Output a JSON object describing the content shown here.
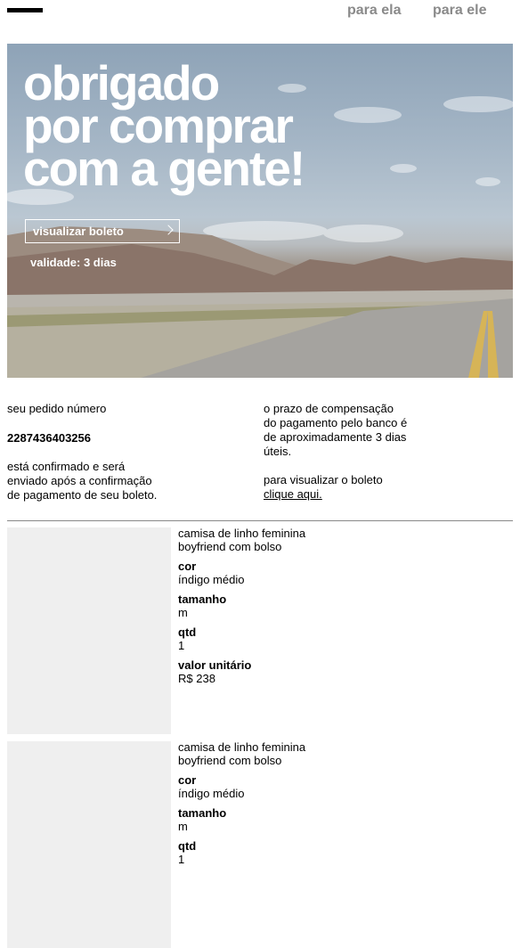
{
  "nav": {
    "link_ela": "para ela",
    "link_ele": "para ele"
  },
  "hero": {
    "title": "obrigado\npor comprar\ncom a gente!",
    "button_label": "visualizar boleto",
    "validity": "validade: 3 dias"
  },
  "order": {
    "label": "seu pedido número",
    "number": "2287436403256",
    "note": "está confirmado e será\nenviado após a confirmação\nde pagamento de seu boleto.",
    "payment_info": "o prazo de compensação\ndo pagamento pelo banco é\nde aproximadamente 3 dias\núteis.",
    "boleto_text": "para visualizar o boleto",
    "boleto_link": "clique aqui."
  },
  "products": [
    {
      "name": "camisa de linho feminina\nboyfriend com bolso",
      "color_label": "cor",
      "color": "índigo médio",
      "size_label": "tamanho",
      "size": "m",
      "qty_label": "qtd",
      "qty": "1",
      "price_label": "valor unitário",
      "price": "R$ 238"
    },
    {
      "name": "camisa de linho feminina\nboyfriend com bolso",
      "color_label": "cor",
      "color": "índigo médio",
      "size_label": "tamanho",
      "size": "m",
      "qty_label": "qtd",
      "qty": "1"
    }
  ]
}
